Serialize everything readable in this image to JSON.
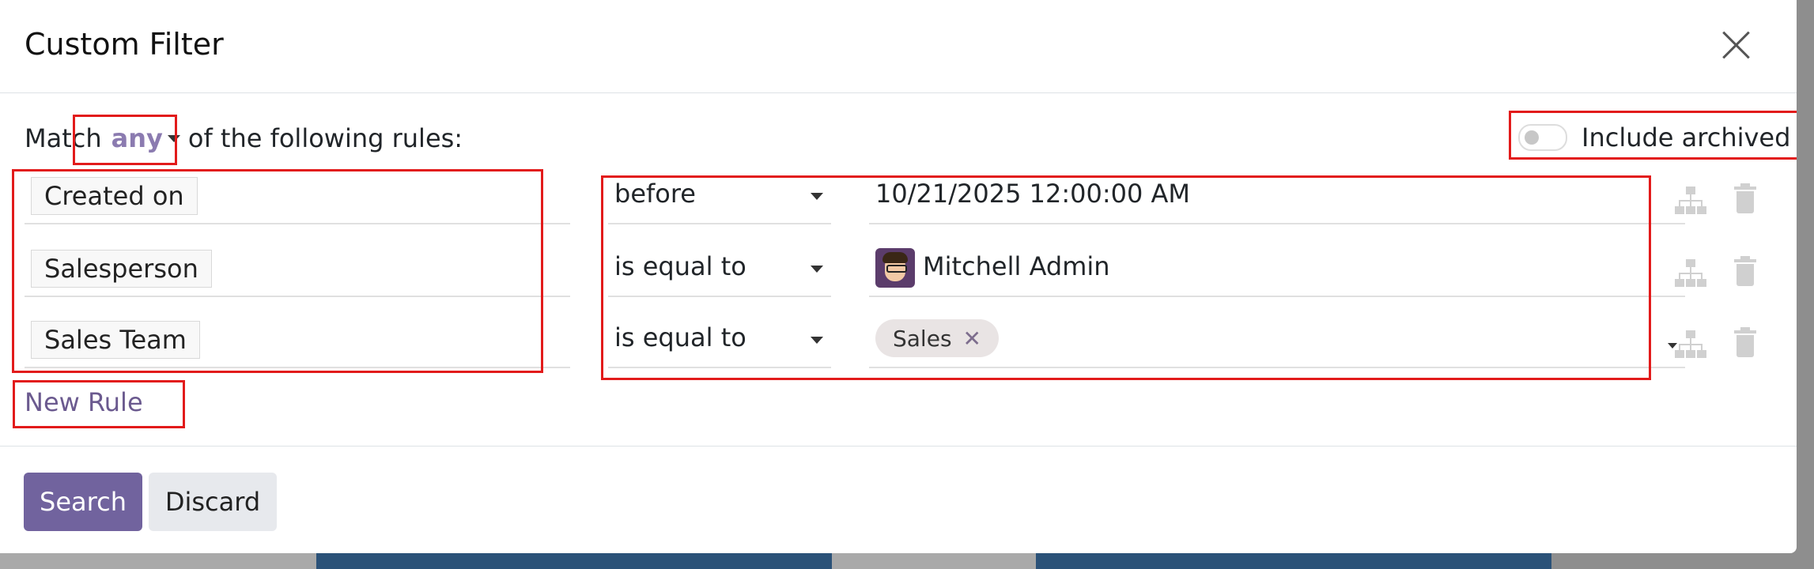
{
  "dialog": {
    "title": "Custom Filter"
  },
  "match": {
    "prefix": "Match",
    "selector": "any",
    "suffix": "of the following rules:"
  },
  "include_archived": {
    "label": "Include archived",
    "enabled": false
  },
  "rules": [
    {
      "field": "Created on",
      "operator": "before",
      "value": "10/21/2025 12:00:00 AM"
    },
    {
      "field": "Salesperson",
      "operator": "is equal to",
      "value": "Mitchell Admin"
    },
    {
      "field": "Sales Team",
      "operator": "is equal to",
      "value": "Sales"
    }
  ],
  "actions": {
    "new_rule": "New Rule",
    "search": "Search",
    "discard": "Discard"
  },
  "colors": {
    "primary": "#71639e",
    "highlight": "#e21b1b",
    "accent_text": "#8b7bb0"
  },
  "icons": {
    "close": "close-icon",
    "hierarchy": "hierarchy-icon",
    "trash": "trash-icon",
    "dropdown": "chevron-down-icon"
  }
}
